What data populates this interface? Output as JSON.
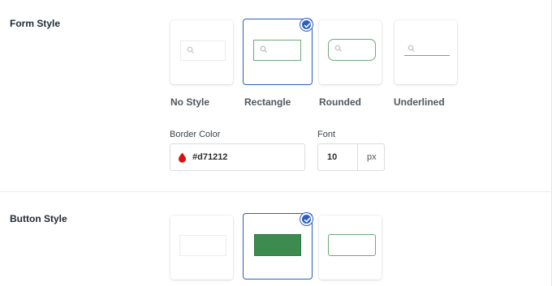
{
  "form_style": {
    "title": "Form Style",
    "options": [
      {
        "label": "No Style",
        "selected": false
      },
      {
        "label": "Rectangle",
        "selected": true
      },
      {
        "label": "Rounded",
        "selected": false
      },
      {
        "label": "Underlined",
        "selected": false
      }
    ],
    "border_color": {
      "label": "Border Color",
      "value": "#d71212",
      "swatch": "#d71212"
    },
    "font": {
      "label": "Font",
      "value": "10",
      "unit": "px"
    }
  },
  "button_style": {
    "title": "Button Style",
    "options": [
      {
        "name": "plain",
        "selected": false
      },
      {
        "name": "filled",
        "selected": true
      },
      {
        "name": "outlined",
        "selected": false
      }
    ],
    "fill_color": "#3d8b4f"
  },
  "colors": {
    "accent": "#2c5fc0",
    "preview_green": "#6fa878"
  }
}
